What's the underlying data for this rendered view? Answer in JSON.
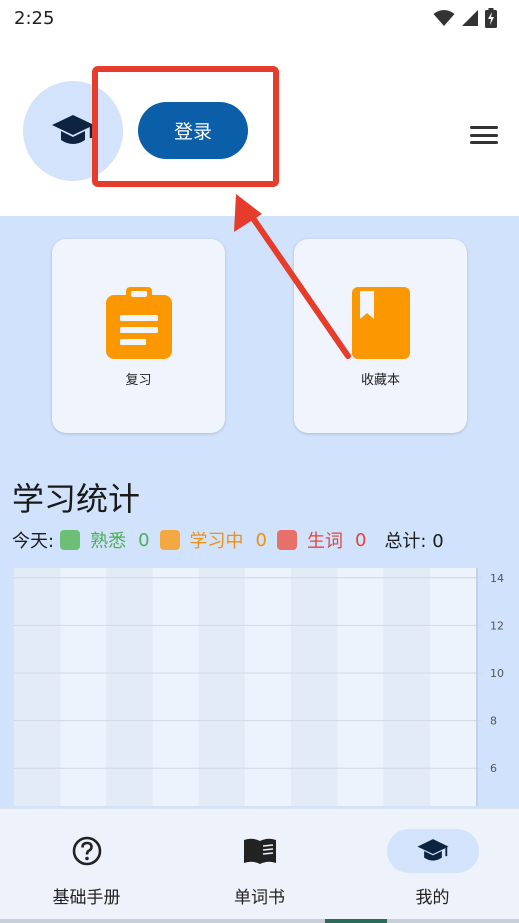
{
  "status_bar": {
    "time": "2:25"
  },
  "header": {
    "avatar_icon": "graduation-cap-icon",
    "login_label": "登录",
    "menu_icon": "hamburger-menu-icon"
  },
  "quick_actions": [
    {
      "label": "复习",
      "icon": "clipboard-icon",
      "color": "#fb9800"
    },
    {
      "label": "收藏本",
      "icon": "bookmark-book-icon",
      "color": "#fb9800"
    }
  ],
  "stats": {
    "title": "学习统计",
    "today_label": "今天:",
    "familiar_label": "熟悉",
    "familiar_value": "0",
    "familiar_color": "#6dbf75",
    "learning_label": "学习中",
    "learning_value": "0",
    "learning_color": "#f3a842",
    "new_label": "生词",
    "new_value": "0",
    "new_color": "#e8706a",
    "total_label": "总计: 0"
  },
  "chart_data": {
    "type": "bar",
    "categories": [
      "",
      "",
      "",
      "",
      "",
      "",
      "",
      "",
      "",
      ""
    ],
    "values": [
      0,
      0,
      0,
      0,
      0,
      0,
      0,
      0,
      0,
      0
    ],
    "y_ticks": [
      "14",
      "12",
      "10",
      "8",
      "6"
    ],
    "ylim": [
      5,
      15
    ],
    "grid": true
  },
  "bottom_nav": [
    {
      "label": "基础手册",
      "icon": "help-circle-icon",
      "active": false
    },
    {
      "label": "单词书",
      "icon": "open-book-icon",
      "active": false
    },
    {
      "label": "我的",
      "icon": "graduation-cap-icon",
      "active": true
    }
  ],
  "colors": {
    "accent": "#0b5ea8",
    "highlight": "#e53c2b",
    "content_bg": "#d1e3fc",
    "icon_orange": "#fb9800"
  }
}
